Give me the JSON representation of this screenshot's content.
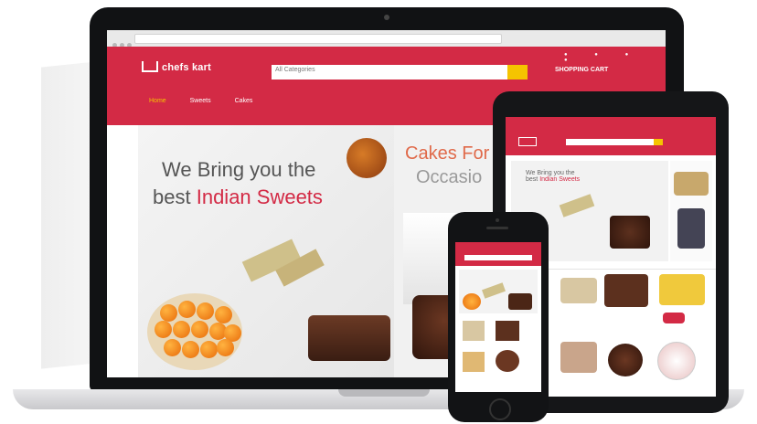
{
  "laptop": {
    "logo_text": "chefs kart",
    "search_category": "All Categories",
    "cart_label": "SHOPPING CART",
    "nav": [
      "Home",
      "Sweets",
      "Cakes"
    ],
    "hero": {
      "line1": "We Bring you the",
      "line2_prefix": "best",
      "line2_highlight": "Indian Sweets"
    },
    "hero2": {
      "title": "Cakes For",
      "subtitle": "Occasio"
    }
  },
  "tablet": {
    "banner_line1": "We Bring you the",
    "banner_line2_prefix": "best",
    "banner_line2_highlight": "Indian Sweets"
  },
  "colors": {
    "brand_red": "#d32a45",
    "accent_yellow": "#f5c400"
  }
}
